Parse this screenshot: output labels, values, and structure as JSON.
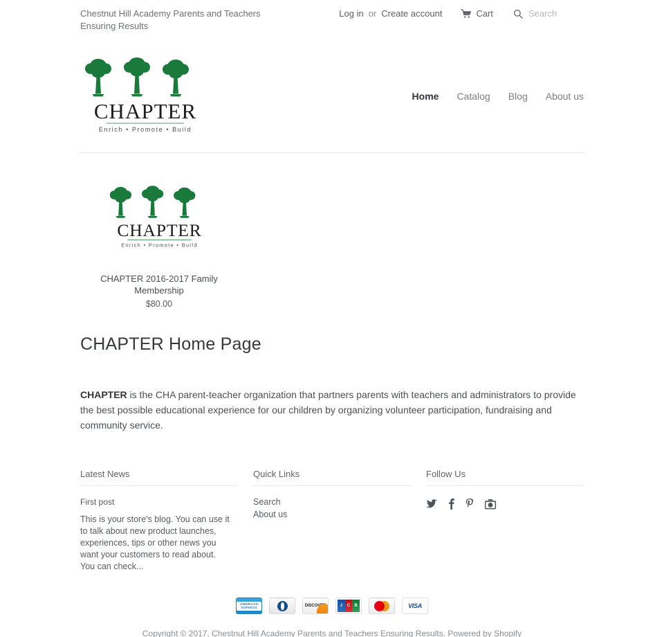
{
  "topbar": {
    "site_tagline": "Chestnut Hill Academy Parents and Teachers Ensuring Results",
    "login_label": "Log in",
    "or_label": "or",
    "create_account_label": "Create account",
    "cart_label": "Cart",
    "search_placeholder": "Search",
    "search_value": ""
  },
  "logo": {
    "wordmark": "CHAPTER",
    "tagline": "Enrich • Promote • Build",
    "green": "#1a7a3c",
    "ink": "#1d1d1b"
  },
  "nav": {
    "items": [
      {
        "label": "Home",
        "active": true
      },
      {
        "label": "Catalog",
        "active": false
      },
      {
        "label": "Blog",
        "active": false
      },
      {
        "label": "About us",
        "active": false
      }
    ]
  },
  "products": [
    {
      "title": "CHAPTER 2016-2017 Family Membership",
      "price": "$80.00"
    }
  ],
  "main": {
    "page_title": "CHAPTER Home Page",
    "body_lead": "CHAPTER",
    "body_text": " is the CHA parent-teacher organization that partners parents with teachers and administrators to provide the best possible educational experience for our children by organizing volunteer participation, fundraising and community service."
  },
  "footer": {
    "latest_news": {
      "title": "Latest News",
      "post_title": "First post",
      "post_excerpt": "This is your store's blog. You can use it to talk about new product launches, experiences, tips or other news you want your customers to read about. You can check..."
    },
    "quick_links": {
      "title": "Quick Links",
      "links": [
        {
          "label": "Search"
        },
        {
          "label": "About us"
        }
      ]
    },
    "follow_us": {
      "title": "Follow Us",
      "socials": [
        {
          "name": "twitter"
        },
        {
          "name": "facebook"
        },
        {
          "name": "pinterest"
        },
        {
          "name": "instagram"
        }
      ]
    },
    "payments": [
      {
        "name": "american-express",
        "label": "AMERICAN EXPRESS"
      },
      {
        "name": "diners-club",
        "label": "Diners Club"
      },
      {
        "name": "discover",
        "label": "DISCOVER"
      },
      {
        "name": "jcb",
        "label": "JCB"
      },
      {
        "name": "mastercard",
        "label": "MasterCard"
      },
      {
        "name": "visa",
        "label": "VISA"
      }
    ],
    "copyright": "Copyright © 2017, Chestnut Hill Academy Parents and Teachers Ensuring Results.",
    "powered_by": "Powered by Shopify"
  }
}
